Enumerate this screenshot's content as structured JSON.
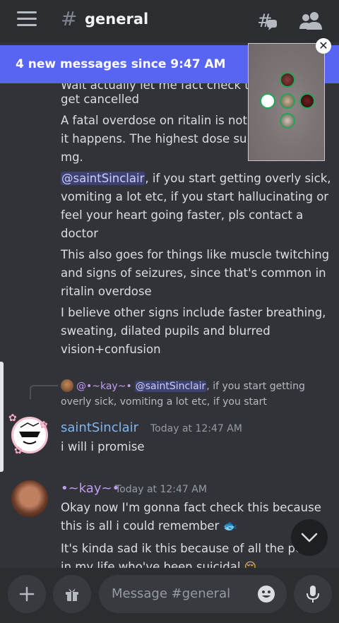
{
  "header": {
    "hash": "#",
    "channel": "general"
  },
  "banner": {
    "text": "4 new messages since 9:47 AM"
  },
  "message_lines": [
    {
      "text": "Wait actually let me fact check th"
    },
    {
      "text": "get cancelled"
    },
    {
      "text": "A fatal overdose on ritalin is not c"
    },
    {
      "text": "it happens. The highest dose surv"
    },
    {
      "text": "mg."
    },
    {
      "mention": "@saintSinclair",
      "rest": ", if you start getting overly sick,"
    },
    {
      "text": "vomiting a lot etc, if you start hallucinating or"
    },
    {
      "text": "feel your heart going faster, pls contact a"
    },
    {
      "text": "doctor"
    },
    {
      "text": "This also goes for things like muscle twitching"
    },
    {
      "text": "and signs of seizures, since that's common in"
    },
    {
      "text": "ritalin overdose"
    },
    {
      "text": "I believe other signs include faster breathing,"
    },
    {
      "text": "sweating, dilated pupils and blurred"
    },
    {
      "text": "vision+confusion"
    }
  ],
  "reply": {
    "author": "@•~kay~•",
    "mention": "@saintSinclair",
    "line1_rest": ", if you start getting",
    "line2": "overly sick, vomiting a lot etc, if you start"
  },
  "sinclair_message": {
    "username": "saintSinclair",
    "time": "Today at 12:47 AM",
    "text": "i will i promise"
  },
  "kay_message": {
    "username": "•~kay~•",
    "time": "Today at 12:47 AM",
    "line1": "Okay now I'm gonna fact check this because",
    "line2": "this is all i could remember",
    "line2_emoji": "🐟",
    "line3": "It's kinda sad ik this because of all the peo",
    "line4": "in my life who've been suicidal",
    "line4_emoji": "😔"
  },
  "composer": {
    "placeholder": "Message #general"
  },
  "pip": {
    "close": "✕"
  },
  "colors": {
    "accent": "#5865f2",
    "sinclair_name": "#7fb6f0",
    "kay_name": "#c29cf0",
    "background": "#313338"
  }
}
